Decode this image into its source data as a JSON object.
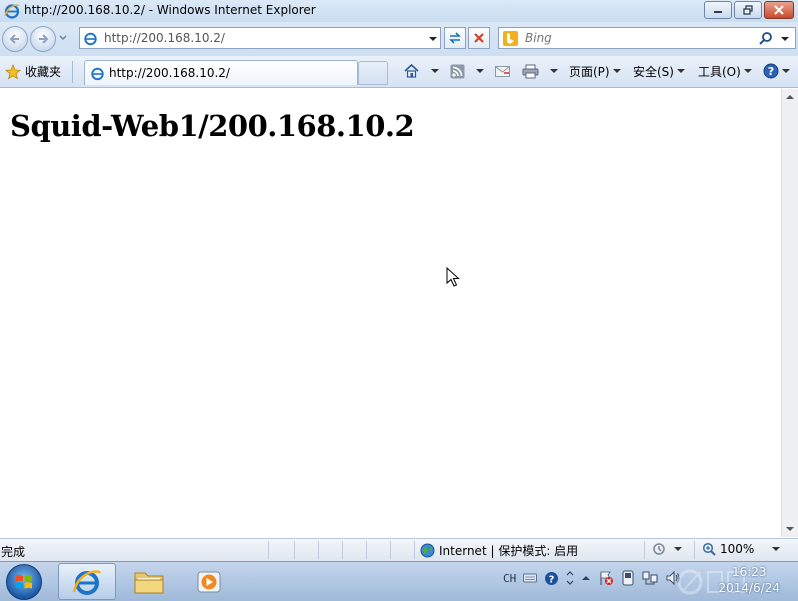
{
  "window": {
    "title": "http://200.168.10.2/ - Windows Internet Explorer"
  },
  "address_bar": {
    "url": "http://200.168.10.2/"
  },
  "search": {
    "placeholder": "Bing"
  },
  "favorites": {
    "label": "收藏夹"
  },
  "tab": {
    "label": "http://200.168.10.2/"
  },
  "command_bar": {
    "page_label": "页面(P)",
    "safety_label": "安全(S)",
    "tools_label": "工具(O)"
  },
  "page": {
    "heading": "Squid-Web1/200.168.10.2"
  },
  "status_bar": {
    "status": "完成",
    "zone": "Internet | 保护模式: 启用",
    "zoom": "100%"
  },
  "taskbar": {
    "language": "CH",
    "time": "16:23",
    "date": "2014/6/24"
  },
  "colors": {
    "ie_blue": "#1e73c8",
    "chrome_light": "#dbe8f6",
    "close_red": "#c94a2a"
  },
  "icons": [
    "ie-icon",
    "back-arrow-icon",
    "forward-arrow-icon",
    "refresh-icon",
    "stop-icon",
    "bing-icon",
    "search-icon",
    "favorites-star-icon",
    "home-icon",
    "rss-icon",
    "mail-icon",
    "print-icon",
    "help-icon",
    "globe-icon",
    "zoom-icon",
    "windows-logo-icon",
    "folder-icon",
    "media-player-icon",
    "volume-icon"
  ]
}
